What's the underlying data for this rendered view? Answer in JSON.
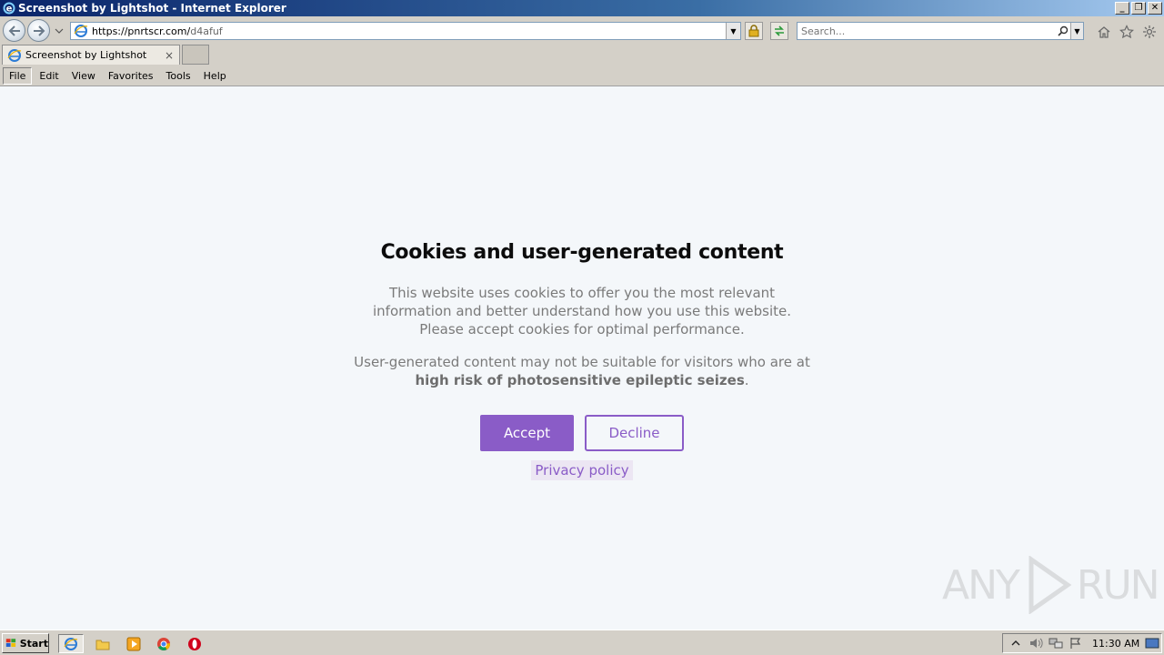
{
  "window": {
    "title": "Screenshot by Lightshot - Internet Explorer",
    "minimize": "_",
    "maximize": "❐",
    "close": "✕"
  },
  "navigation": {
    "url_host": "https://pnrtscr.com/",
    "url_path": "d4afuf",
    "search_placeholder": "Search..."
  },
  "tabs": [
    {
      "title": "Screenshot by Lightshot",
      "close": "×"
    }
  ],
  "menu": {
    "items": [
      "File",
      "Edit",
      "View",
      "Favorites",
      "Tools",
      "Help"
    ]
  },
  "consent": {
    "title": "Cookies and user-generated content",
    "paragraph1": [
      "This website uses cookies to offer you the most relevant",
      "information and better understand how you use this website.",
      "Please accept cookies for optimal performance."
    ],
    "paragraph2_prefix": "User-generated content may not be suitable for visitors who are at",
    "paragraph2_bold": "high risk of photosensitive epileptic seizes",
    "paragraph2_suffix": ".",
    "accept_label": "Accept",
    "decline_label": "Decline",
    "privacy_label": "Privacy policy",
    "accent_color": "#8a5cc7"
  },
  "watermark": {
    "left": "ANY",
    "right": "RUN"
  },
  "taskbar": {
    "start_label": "Start",
    "clock": "11:30 AM"
  }
}
